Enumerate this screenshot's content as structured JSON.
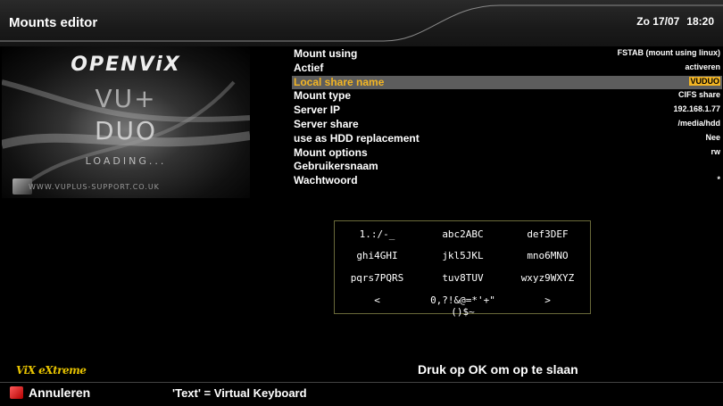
{
  "header": {
    "title": "Mounts editor",
    "day": "Zo 17/07",
    "time": "18:20"
  },
  "splash": {
    "title": "OPENViX",
    "model_line1": "VU+",
    "model_line2": "DUO",
    "loading": "LOADING...",
    "url": "WWW.VUPLUS-SUPPORT.CO.UK"
  },
  "config": [
    {
      "label": "Mount using",
      "value": "FSTAB (mount using linux)"
    },
    {
      "label": "Actief",
      "value": "activeren"
    },
    {
      "label": "Local share name",
      "value": "VUDUO",
      "selected": true
    },
    {
      "label": "Mount type",
      "value": "CIFS share"
    },
    {
      "label": "Server IP",
      "value": "192.168.1.77"
    },
    {
      "label": "Server share",
      "value": "/media/hdd"
    },
    {
      "label": "use as HDD replacement",
      "value": "Nee"
    },
    {
      "label": "Mount options",
      "value": "rw"
    },
    {
      "label": "Gebruikersnaam",
      "value": ""
    },
    {
      "label": "Wachtwoord",
      "value": "*"
    }
  ],
  "keyboard": [
    [
      "1.:/-_",
      "abc2ABC",
      "def3DEF"
    ],
    [
      "ghi4GHI",
      "jkl5JKL",
      "mno6MNO"
    ],
    [
      "pqrs7PQRS",
      "tuv8TUV",
      "wxyz9WXYZ"
    ],
    [
      "<",
      "0,?!&@=*'+\"()$~",
      ">"
    ]
  ],
  "footer": {
    "logo": "ViX eXtreme",
    "hint": "Druk op OK om op te slaan",
    "red_label": "Annuleren",
    "text_hint": "'Text' = Virtual Keyboard"
  },
  "colors": {
    "highlight_bar": "#5d5d5d",
    "selected_text": "#f3b523",
    "red_key": "#d01010",
    "logo": "#e6c200"
  }
}
